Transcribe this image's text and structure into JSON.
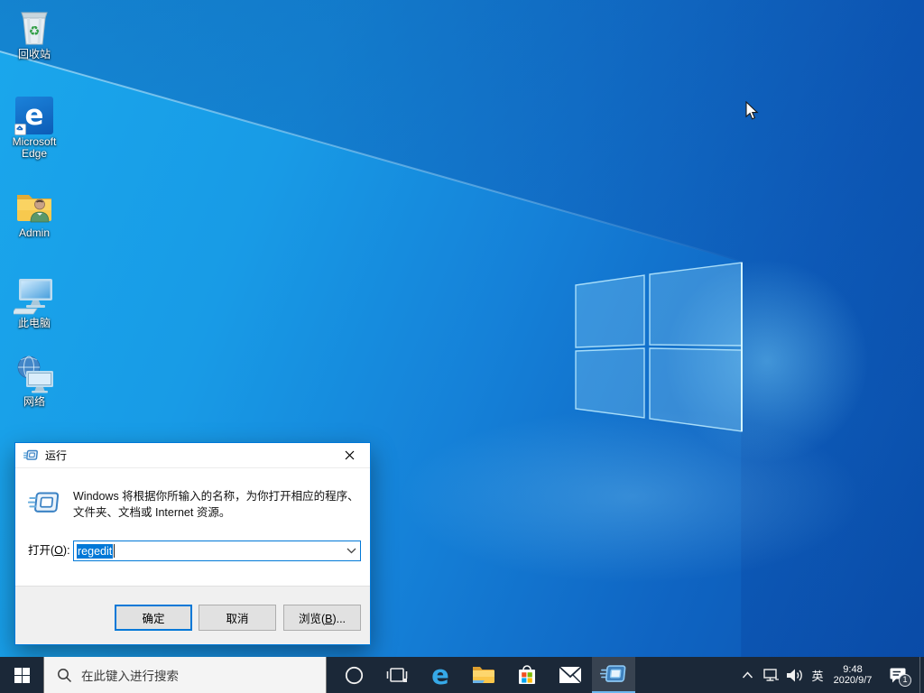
{
  "colors": {
    "accent": "#0078d7",
    "taskbar_bg": "#1b2838",
    "selection_bg": "#0078d7",
    "dialog_footer": "#f0f0f0"
  },
  "desktop": {
    "icons": [
      {
        "label": "回收站"
      },
      {
        "label": "Microsoft Edge"
      },
      {
        "label": "Admin"
      },
      {
        "label": "此电脑"
      },
      {
        "label": "网络"
      }
    ]
  },
  "run_dialog": {
    "title": "运行",
    "description": "Windows 将根据你所输入的名称，为你打开相应的程序、文件夹、文档或 Internet 资源。",
    "open_label_prefix": "打开(",
    "open_label_mnemonic": "O",
    "open_label_suffix": "):",
    "input_value": "regedit",
    "ok_label": "确定",
    "cancel_label": "取消",
    "browse_label_prefix": "浏览(",
    "browse_label_mnemonic": "B",
    "browse_label_suffix": ")..."
  },
  "taskbar": {
    "search_placeholder": "在此键入进行搜索"
  },
  "tray": {
    "ime": "英",
    "time": "9:48",
    "date": "2020/9/7",
    "notification_count": "1"
  },
  "icons": {
    "recycle_glyph": "♻"
  }
}
